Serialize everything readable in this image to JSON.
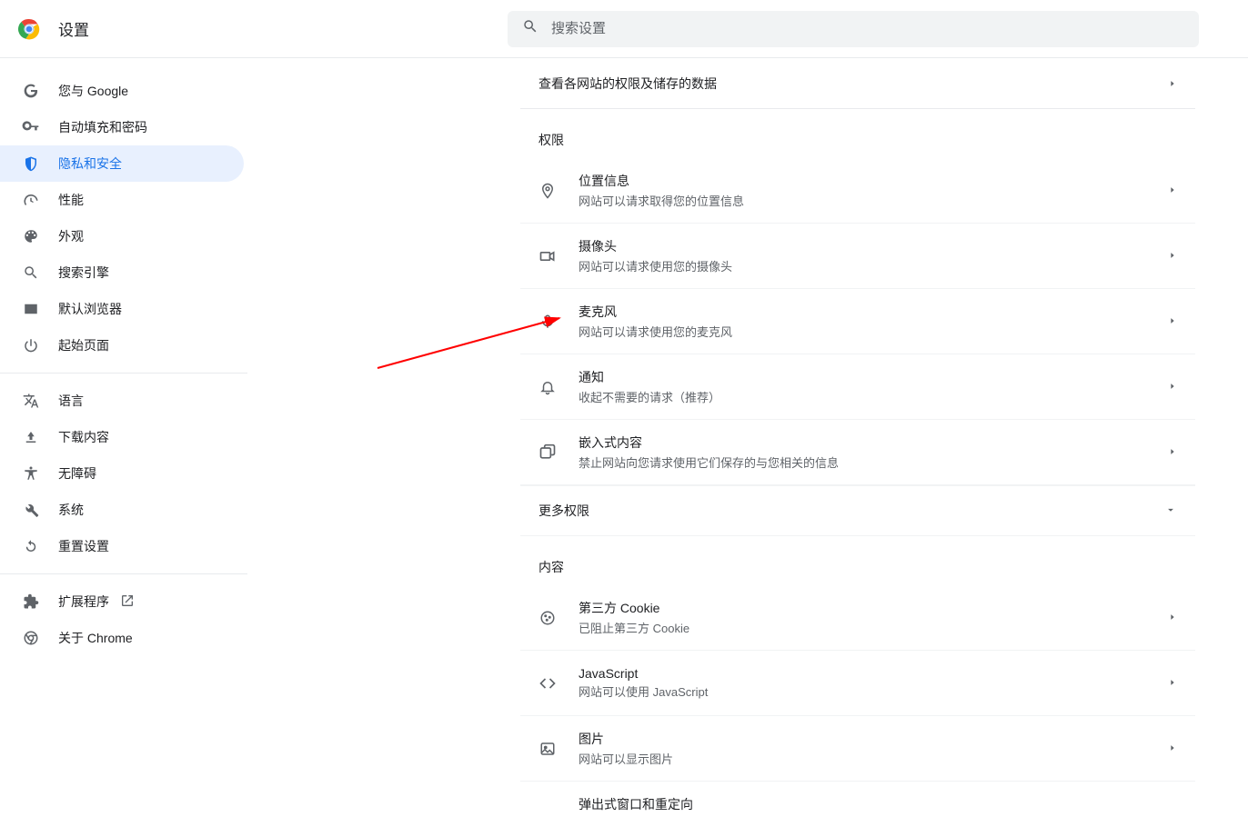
{
  "header": {
    "title": "设置",
    "search_placeholder": "搜索设置"
  },
  "sidebar": {
    "items": [
      {
        "label": "您与 Google"
      },
      {
        "label": "自动填充和密码"
      },
      {
        "label": "隐私和安全"
      },
      {
        "label": "性能"
      },
      {
        "label": "外观"
      },
      {
        "label": "搜索引擎"
      },
      {
        "label": "默认浏览器"
      },
      {
        "label": "起始页面"
      }
    ],
    "items2": [
      {
        "label": "语言"
      },
      {
        "label": "下载内容"
      },
      {
        "label": "无障碍"
      },
      {
        "label": "系统"
      },
      {
        "label": "重置设置"
      }
    ],
    "items3": [
      {
        "label": "扩展程序"
      },
      {
        "label": "关于 Chrome"
      }
    ]
  },
  "content": {
    "view_sites_label": "查看各网站的权限及储存的数据",
    "permissions_title": "权限",
    "more_permissions_label": "更多权限",
    "content_title": "内容",
    "permissions": [
      {
        "title": "位置信息",
        "subtitle": "网站可以请求取得您的位置信息"
      },
      {
        "title": "摄像头",
        "subtitle": "网站可以请求使用您的摄像头"
      },
      {
        "title": "麦克风",
        "subtitle": "网站可以请求使用您的麦克风"
      },
      {
        "title": "通知",
        "subtitle": "收起不需要的请求（推荐）"
      },
      {
        "title": "嵌入式内容",
        "subtitle": "禁止网站向您请求使用它们保存的与您相关的信息"
      }
    ],
    "content_rows": [
      {
        "title": "第三方 Cookie",
        "subtitle": "已阻止第三方 Cookie"
      },
      {
        "title": "JavaScript",
        "subtitle": "网站可以使用 JavaScript"
      },
      {
        "title": "图片",
        "subtitle": "网站可以显示图片"
      },
      {
        "title": "弹出式窗口和重定向",
        "subtitle": ""
      }
    ]
  }
}
